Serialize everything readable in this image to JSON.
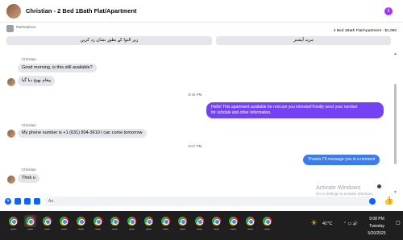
{
  "header": {
    "title": "Christian - 2 Bed 1Bath Flat/Apartment",
    "info_icon": "i"
  },
  "marketplace": {
    "label": "Marketplace",
    "listing": "2 Bed 1Bath Flat/Apartment - $1,050",
    "left_button": "زیر التوا کے بطور نشان زد کریں",
    "right_button": "مزید آپشنز"
  },
  "messages": {
    "sender_name_1": "Christian",
    "in_1": "Good morning, is this still available?",
    "in_2": "پیغام بھیج دیا گیا",
    "time_1": "8:40 PM",
    "out_1_line1": "Hello! This apartment available for rent.are you intrested?kindly send your number",
    "out_1_line2": "for schdule and other information.",
    "sender_name_2": "Christian",
    "in_3": "My phone number is +1 (631) 804-3610 I can come tomorrow",
    "time_2": "9:07 PM",
    "out_2": "Thanks I\"ll message you in a moment",
    "sender_name_3": "Christian",
    "in_4": "Thnk u"
  },
  "composer": {
    "placeholder": "Aa"
  },
  "watermark": {
    "line1": "Activate Windows",
    "line2": "Go to Settings to activate Windows."
  },
  "taskbar": {
    "temperature": "41°C",
    "time": "9:08 PM",
    "day": "Tuesday",
    "date": "5/20/2025"
  },
  "colors": {
    "outgoing_bubble": "#7442f5",
    "outgoing_bubble_alt": "#3b7cf0",
    "incoming_bubble": "#e4e6eb",
    "accent": "#0866ff"
  }
}
